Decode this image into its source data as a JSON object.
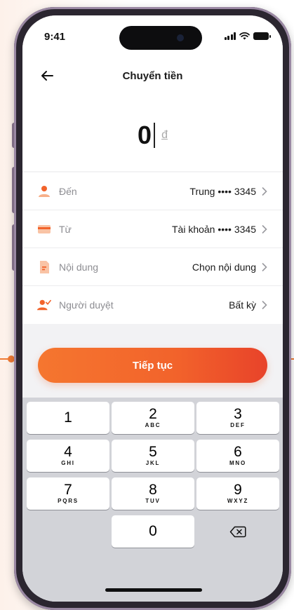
{
  "status_bar": {
    "time": "9:41"
  },
  "header": {
    "title": "Chuyển tiền"
  },
  "amount": {
    "value": "0",
    "currency": "đ"
  },
  "rows": [
    {
      "label": "Đến",
      "value": "Trung •••• 3345",
      "icon": "person-icon"
    },
    {
      "label": "Từ",
      "value": "Tài khoản •••• 3345",
      "icon": "card-icon"
    },
    {
      "label": "Nội dung",
      "value": "Chọn nội dung",
      "icon": "document-icon"
    },
    {
      "label": "Người duyệt",
      "value": "Bất kỳ",
      "icon": "approver-icon"
    }
  ],
  "cta": {
    "label": "Tiếp tục"
  },
  "keypad": {
    "keys": [
      {
        "num": "1",
        "sub": ""
      },
      {
        "num": "2",
        "sub": "ABC"
      },
      {
        "num": "3",
        "sub": "DEF"
      },
      {
        "num": "4",
        "sub": "GHI"
      },
      {
        "num": "5",
        "sub": "JKL"
      },
      {
        "num": "6",
        "sub": "MNO"
      },
      {
        "num": "7",
        "sub": "PQRS"
      },
      {
        "num": "8",
        "sub": "TUV"
      },
      {
        "num": "9",
        "sub": "WXYZ"
      },
      {
        "num": "0",
        "sub": ""
      }
    ],
    "delete_icon": "backspace-icon"
  },
  "colors": {
    "accent": "#f2632b",
    "accent_dark": "#e8432a"
  }
}
